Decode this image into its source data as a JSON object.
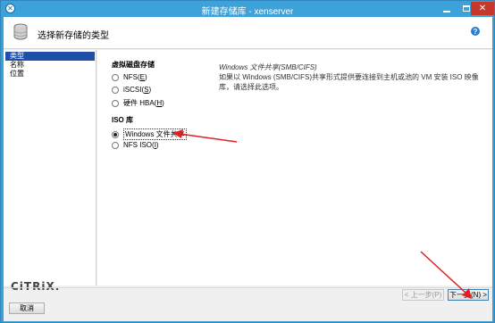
{
  "window": {
    "title": "新建存储库 - xenserver",
    "close_glyph": "✕"
  },
  "header": {
    "title": "选择新存储的类型",
    "help_glyph": "?"
  },
  "sidebar": {
    "items": [
      {
        "label": "类型",
        "active": true
      },
      {
        "label": "名称",
        "active": false
      },
      {
        "label": "位置",
        "active": false
      }
    ],
    "logo": "CiTRiX."
  },
  "virtual_disk": {
    "heading": "虚拟磁盘存储",
    "options": [
      {
        "label": "NFS",
        "accel": "E",
        "checked": false
      },
      {
        "label": "iSCSI",
        "accel": "S",
        "checked": false
      },
      {
        "label": "硬件 HBA",
        "accel": "H",
        "checked": false
      }
    ]
  },
  "iso_library": {
    "heading": "ISO 库",
    "options": [
      {
        "label": "Windows 文件共享",
        "checked": true
      },
      {
        "label": "NFS ISO",
        "accel": "I",
        "checked": false
      }
    ]
  },
  "description": {
    "title": "Windows 文件共享(SMB/CIFS)",
    "body": "如果以 Windows (SMB/CIFS)共享形式提供要连接到主机或池的 VM 安装 ISO 映像库，请选择此选项。"
  },
  "footer": {
    "prev_label": "< 上一步(P)",
    "next_label": "下一步(N) >",
    "cancel_label": "取消"
  },
  "colors": {
    "title_bar": "#3da2da",
    "selection": "#1f4fa8",
    "annotation_arrow": "#e02020"
  }
}
